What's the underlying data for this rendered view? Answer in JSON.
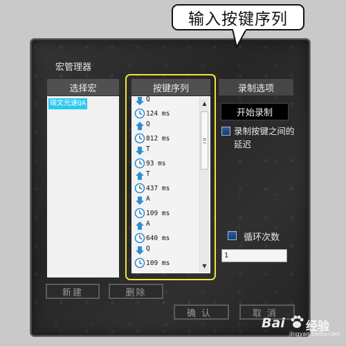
{
  "callout": {
    "text": "输入按键序列"
  },
  "dialog": {
    "title": "宏管理器",
    "columns": {
      "select_macro": "选择宏",
      "key_sequence": "按键序列",
      "record_options": "录制选项"
    },
    "macros": [
      "瑞文光速QA"
    ],
    "sequence": [
      {
        "kind": "key",
        "dir": "down",
        "text": "Q"
      },
      {
        "kind": "delay",
        "text": "124 ms"
      },
      {
        "kind": "key",
        "dir": "up",
        "text": "Q"
      },
      {
        "kind": "delay",
        "text": "812 ms"
      },
      {
        "kind": "key",
        "dir": "down",
        "text": "T"
      },
      {
        "kind": "delay",
        "text": "93 ms"
      },
      {
        "kind": "key",
        "dir": "up",
        "text": "T"
      },
      {
        "kind": "delay",
        "text": "437 ms"
      },
      {
        "kind": "key",
        "dir": "down",
        "text": "A"
      },
      {
        "kind": "delay",
        "text": "109 ms"
      },
      {
        "kind": "key",
        "dir": "up",
        "text": "A"
      },
      {
        "kind": "delay",
        "text": "640 ms"
      },
      {
        "kind": "key",
        "dir": "down",
        "text": "Q"
      },
      {
        "kind": "delay",
        "text": "109 ms"
      }
    ],
    "record": {
      "start_button": "开始录制",
      "delay_option": "录制按键之间的延迟",
      "loop_label": "循环次数",
      "loop_value": "1"
    },
    "buttons": {
      "new": "新建",
      "delete": "删除",
      "ok": "确认",
      "cancel": "取消"
    }
  },
  "watermark": {
    "brand": "Bai",
    "name": "经验",
    "url": "jingyan.baidu.com"
  },
  "colors": {
    "highlight": "#f2e63a",
    "selection": "#2cc8f0",
    "arrow_icon": "#2a8fd6"
  }
}
